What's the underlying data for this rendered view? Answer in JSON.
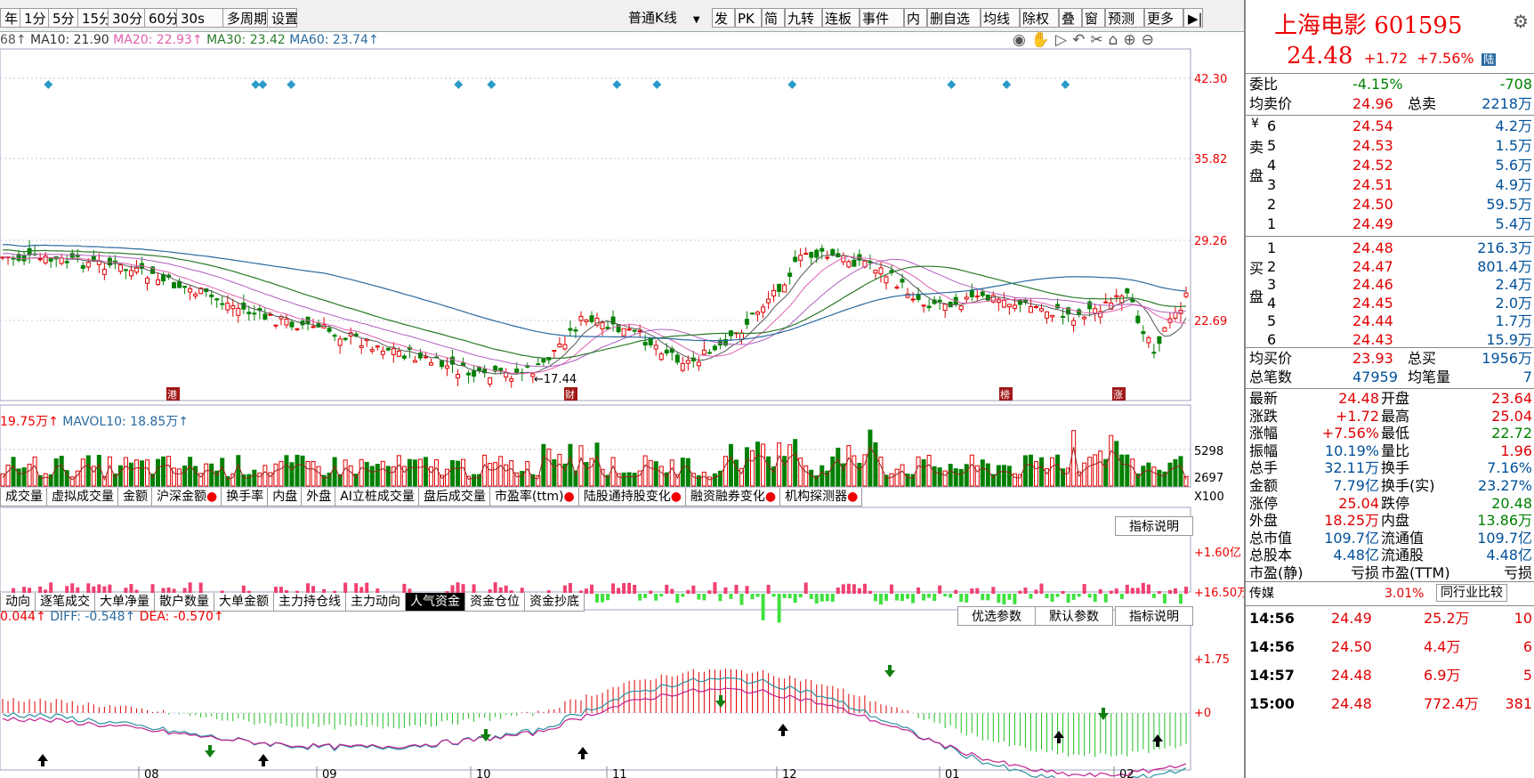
{
  "toolbar": {
    "periods": [
      "年",
      "1分",
      "5分",
      "15分",
      "30分",
      "60分",
      "30s",
      "多周期",
      "设置"
    ],
    "kline_select": "普通K线",
    "tools": [
      "发",
      "PK",
      "简",
      "九转",
      "连板",
      "事件",
      "内",
      "删自选",
      "均线",
      "除权",
      "叠",
      "窗",
      "预测",
      "更多"
    ]
  },
  "ma_legend": {
    "ma5": "68↑",
    "ma10": "MA10: 21.90",
    "ma20": "MA20: 22.93↑",
    "ma30": "MA30: 23.42",
    "ma60": "MA60: 23.74↑"
  },
  "price_axis": [
    "42.30",
    "35.82",
    "29.26",
    "22.69"
  ],
  "price_low_label": "←17.44",
  "event_marks": [
    "港",
    "财",
    "榜",
    "涨"
  ],
  "vol_legend": {
    "vol": "19.75万↑",
    "mavol10": "MAVOL10: 18.85万↑"
  },
  "vol_axis": [
    "5298",
    "2697",
    "X100"
  ],
  "tabs1": [
    "成交量",
    "虚拟成交量",
    "金额",
    "沪深金额",
    "换手率",
    "内盘",
    "外盘",
    "AI立桩成交量",
    "盘后成交量",
    "市盈率(ttm)",
    "陆股通持股变化",
    "融资融券变化",
    "机构探测器"
  ],
  "ind_btn": "指标说明",
  "flow_axis": [
    "+1.60亿",
    "+16.50万"
  ],
  "tabs2": [
    "动向",
    "逐笔成交",
    "大单净量",
    "散户数量",
    "大单金额",
    "主力持仓线",
    "主力动向",
    "人气资金",
    "资金仓位",
    "资金抄底"
  ],
  "macd_legend": {
    "macd": "0.044↑",
    "diff": "DIFF: -0.548↑",
    "dea": "DEA: -0.570↑"
  },
  "macd_btns": [
    "优选参数",
    "默认参数",
    "指标说明"
  ],
  "macd_axis": [
    "+1.75",
    "+0"
  ],
  "months": [
    "08",
    "09",
    "10",
    "11",
    "12",
    "01",
    "02"
  ],
  "colors": {
    "up": "#e00000",
    "down": "#008000",
    "ma5": "#555555",
    "ma10": "#e05fb0",
    "ma20": "#b060c0",
    "ma30": "#2a7a2a",
    "ma60": "#2a6aa0"
  },
  "stock": {
    "name": "上海电影 601595",
    "price": "24.48",
    "change": "+1.72",
    "pct": "+7.56%",
    "badge": "陆"
  },
  "weibi": {
    "label": "委比",
    "pct": "-4.15%",
    "diff": "-708"
  },
  "avg_sell": {
    "label": "均卖价",
    "price": "24.96",
    "label2": "总卖",
    "vol": "2218万"
  },
  "sell_side_label": "卖盘",
  "buy_side_label": "买盘",
  "sell": [
    {
      "n": "6",
      "p": "24.54",
      "v": "4.2万"
    },
    {
      "n": "5",
      "p": "24.53",
      "v": "1.5万"
    },
    {
      "n": "4",
      "p": "24.52",
      "v": "5.6万"
    },
    {
      "n": "3",
      "p": "24.51",
      "v": "4.9万"
    },
    {
      "n": "2",
      "p": "24.50",
      "v": "59.5万"
    },
    {
      "n": "1",
      "p": "24.49",
      "v": "5.4万"
    }
  ],
  "buy": [
    {
      "n": "1",
      "p": "24.48",
      "v": "216.3万"
    },
    {
      "n": "2",
      "p": "24.47",
      "v": "801.4万"
    },
    {
      "n": "3",
      "p": "24.46",
      "v": "2.4万"
    },
    {
      "n": "4",
      "p": "24.45",
      "v": "2.0万"
    },
    {
      "n": "5",
      "p": "24.44",
      "v": "1.7万"
    },
    {
      "n": "6",
      "p": "24.43",
      "v": "15.9万"
    }
  ],
  "avg_buy": {
    "label": "均买价",
    "price": "23.93",
    "label2": "总买",
    "vol": "1956万"
  },
  "total_trades": {
    "label": "总笔数",
    "val": "47959",
    "label2": "均笔量",
    "val2": "7"
  },
  "stats": [
    {
      "l1": "最新",
      "v1": "24.48",
      "c1": "red",
      "l2": "开盘",
      "v2": "23.64",
      "c2": "red"
    },
    {
      "l1": "涨跌",
      "v1": "+1.72",
      "c1": "red",
      "l2": "最高",
      "v2": "25.04",
      "c2": "red"
    },
    {
      "l1": "涨幅",
      "v1": "+7.56%",
      "c1": "red",
      "l2": "最低",
      "v2": "22.72",
      "c2": "grn"
    },
    {
      "l1": "振幅",
      "v1": "10.19%",
      "c1": "blu",
      "l2": "量比",
      "v2": "1.96",
      "c2": "red"
    },
    {
      "l1": "总手",
      "v1": "32.11万",
      "c1": "blu",
      "l2": "换手",
      "v2": "7.16%",
      "c2": "blu"
    },
    {
      "l1": "金额",
      "v1": "7.79亿",
      "c1": "blu",
      "l2": "换手(实)",
      "v2": "23.27%",
      "c2": "blu"
    },
    {
      "l1": "涨停",
      "v1": "25.04",
      "c1": "red",
      "l2": "跌停",
      "v2": "20.48",
      "c2": "grn"
    },
    {
      "l1": "外盘",
      "v1": "18.25万",
      "c1": "red",
      "l2": "内盘",
      "v2": "13.86万",
      "c2": "grn"
    },
    {
      "l1": "总市值",
      "v1": "109.7亿",
      "c1": "blu",
      "l2": "流通值",
      "v2": "109.7亿",
      "c2": "blu"
    },
    {
      "l1": "总股本",
      "v1": "4.48亿",
      "c1": "blu",
      "l2": "流通股",
      "v2": "4.48亿",
      "c2": "blu"
    },
    {
      "l1": "市盈(静)",
      "v1": "亏损",
      "c1": "blk",
      "l2": "市盈(TTM)",
      "v2": "亏损",
      "c2": "blk"
    }
  ],
  "industry": {
    "name": "传媒",
    "pct": "3.01%",
    "btn": "同行业比较"
  },
  "ticks": [
    {
      "t": "14:56",
      "p": "24.49",
      "v": "25.2万",
      "n": "10"
    },
    {
      "t": "14:56",
      "p": "24.50",
      "v": "4.4万",
      "n": "6"
    },
    {
      "t": "14:57",
      "p": "24.48",
      "v": "6.9万",
      "n": "5"
    },
    {
      "t": "15:00",
      "p": "24.48",
      "v": "772.4万",
      "n": "381"
    }
  ]
}
